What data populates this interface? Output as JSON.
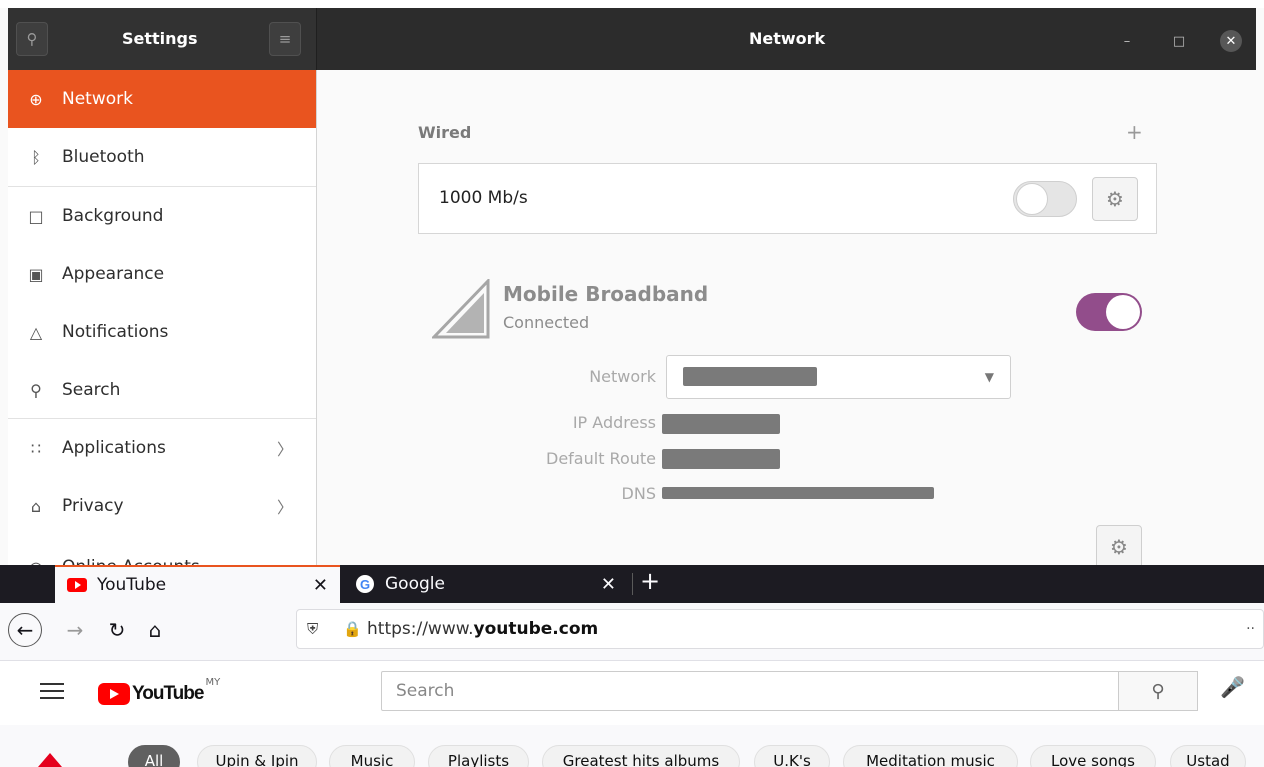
{
  "settings": {
    "title": "Settings",
    "page_title": "Network",
    "sidebar": [
      {
        "label": "Network",
        "icon": "globe-icon",
        "glyph": "⊕",
        "active": true
      },
      {
        "label": "Bluetooth",
        "icon": "bluetooth-icon",
        "glyph": "ᛒ"
      },
      {
        "label": "Background",
        "icon": "monitor-icon",
        "glyph": "□"
      },
      {
        "label": "Appearance",
        "icon": "appearance-icon",
        "glyph": "▣"
      },
      {
        "label": "Notifications",
        "icon": "bell-icon",
        "glyph": "△"
      },
      {
        "label": "Search",
        "icon": "search-icon",
        "glyph": "⚲"
      },
      {
        "label": "Applications",
        "icon": "apps-grid-icon",
        "glyph": "∷"
      },
      {
        "label": "Privacy",
        "icon": "lock-icon",
        "glyph": "⌂"
      },
      {
        "label": "Online Accounts",
        "icon": "accounts-icon",
        "glyph": "○"
      }
    ],
    "wired": {
      "label": "Wired",
      "speed": "1000 Mb/s",
      "enabled": false
    },
    "mobile": {
      "title": "Mobile Broadband",
      "status": "Connected",
      "enabled": true,
      "fields": {
        "network": "Network",
        "ip": "IP Address",
        "route": "Default Route",
        "dns": "DNS"
      }
    },
    "colors": {
      "accent": "#e9541f",
      "toggle_on": "#924d8b"
    }
  },
  "browser": {
    "tabs": [
      {
        "label": "YouTube",
        "icon": "youtube-favicon"
      },
      {
        "label": "Google",
        "icon": "google-favicon"
      }
    ],
    "url_prefix": "https://www.",
    "url_domain": "youtube.com",
    "youtube": {
      "logo": "YouTube",
      "country": "MY",
      "search_placeholder": "Search",
      "chips": [
        "All",
        "Upin & Ipin",
        "Music",
        "Playlists",
        "Greatest hits albums",
        "U.K's",
        "Meditation music",
        "Love songs",
        "Ustad"
      ]
    }
  }
}
